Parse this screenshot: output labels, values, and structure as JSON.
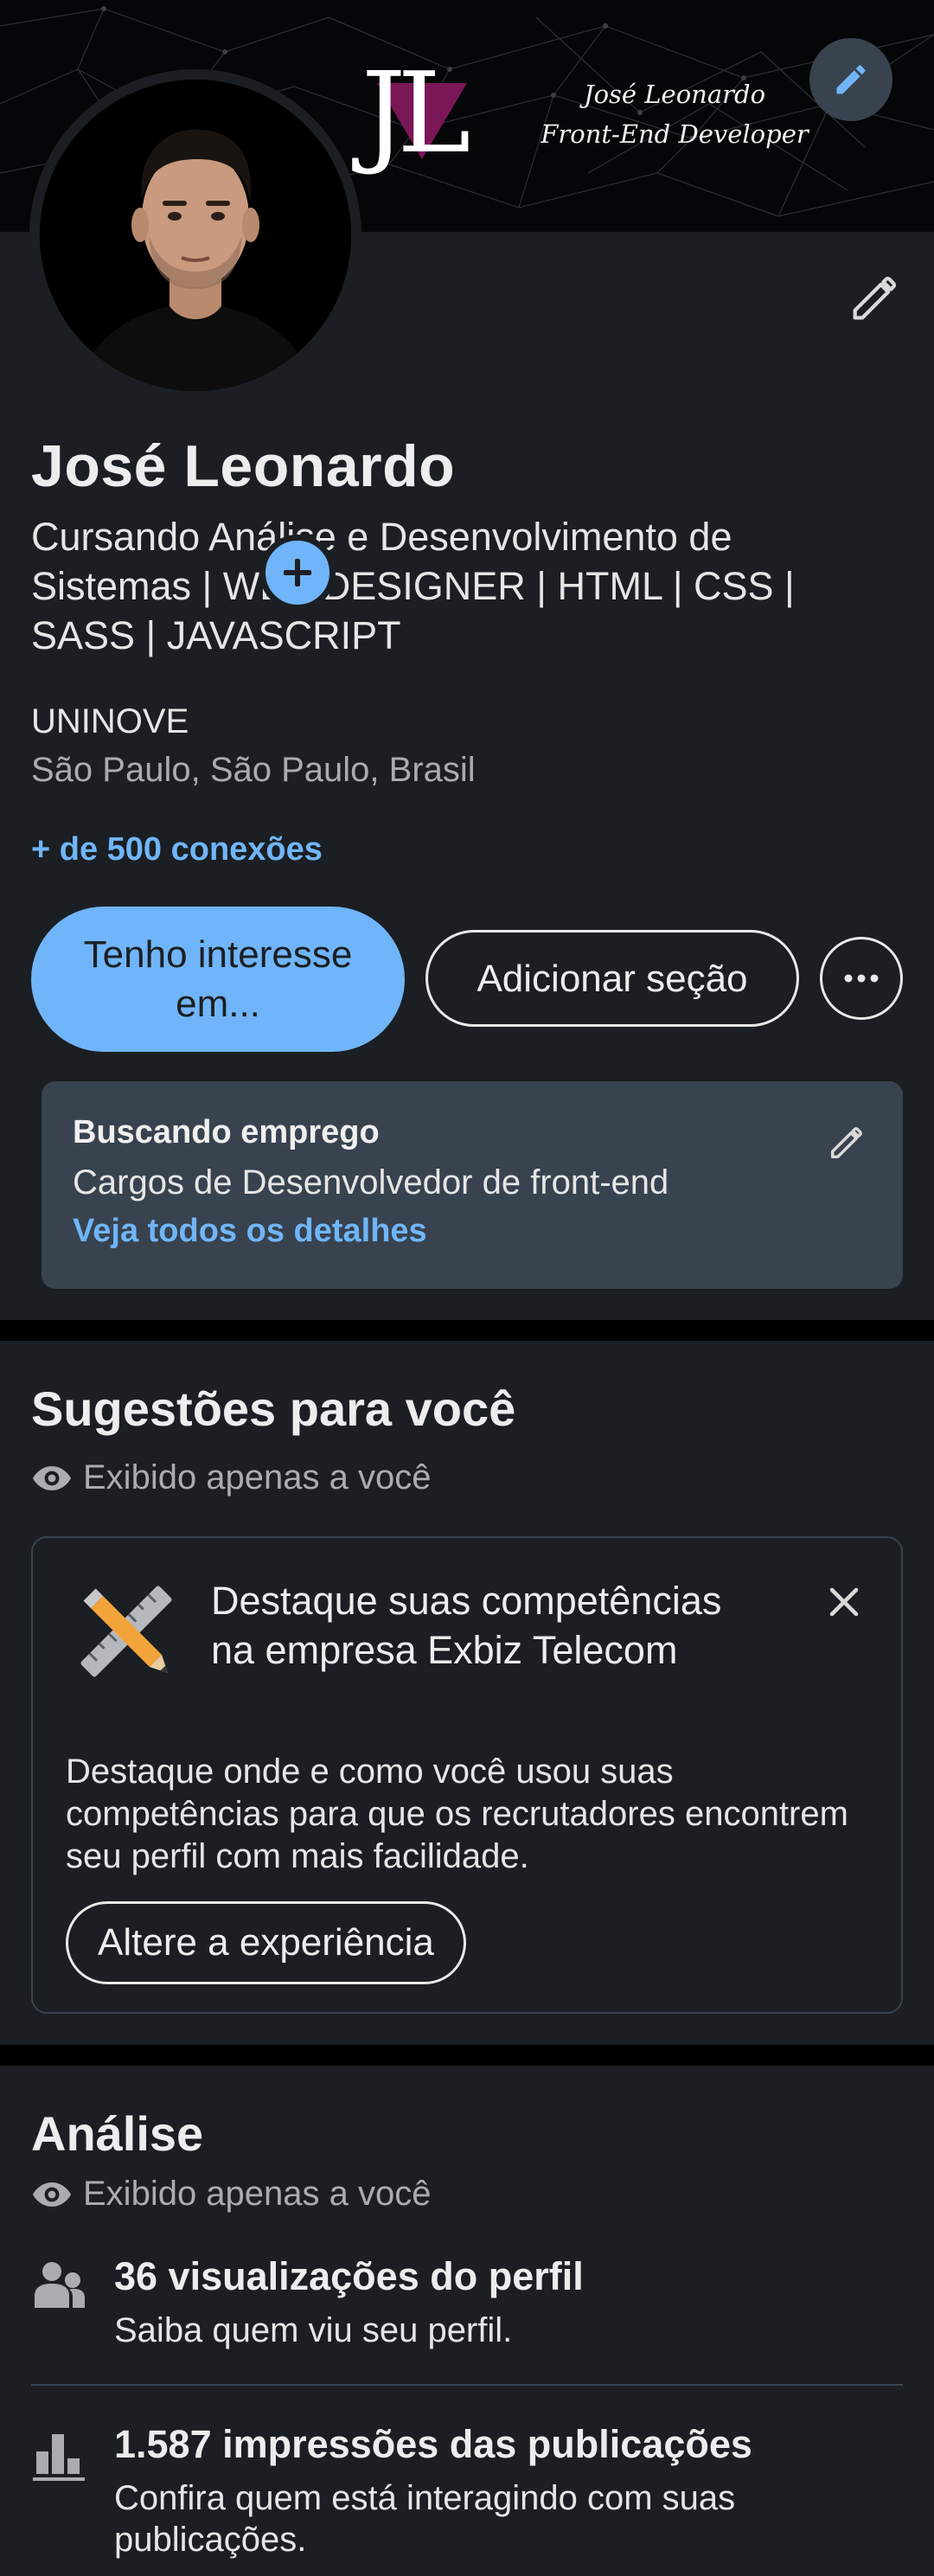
{
  "cover": {
    "logo_text": "JL",
    "name": "José Leonardo",
    "role": "Front-End Developer",
    "edit_icon": "pencil-icon"
  },
  "profile": {
    "name": "José Leonardo",
    "headline": "Cursando Análise e Desenvolvimento de Sistemas | WEB DESIGNER | HTML | CSS | SASS | JAVASCRIPT",
    "company": "UNINOVE",
    "location": "São Paulo, São Paulo, Brasil",
    "connections": "+ de 500 conexões",
    "add_photo_icon": "plus-icon"
  },
  "actions": {
    "primary": "Tenho interesse em...",
    "secondary": "Adicionar seção",
    "more_icon": "more-horizontal-icon"
  },
  "open_to_work": {
    "title": "Buscando emprego",
    "description": "Cargos de Desenvolvedor de front-end",
    "link": "Veja todos os detalhes"
  },
  "suggestions": {
    "title": "Sugestões para você",
    "private_note": "Exibido apenas a você",
    "card": {
      "heading": "Destaque suas competências na empresa Exbiz Telecom",
      "body": "Destaque onde e como você usou suas competências para que os recrutadores encontrem seu perfil com mais facilidade.",
      "button": "Altere a experiência"
    }
  },
  "analytics": {
    "title": "Análise",
    "private_note": "Exibido apenas a você",
    "items": [
      {
        "icon": "people-icon",
        "title": "36 visualizações do perfil",
        "subtitle": "Saiba quem viu seu perfil."
      },
      {
        "icon": "bar-chart-icon",
        "title": "1.587 impressões das publicações",
        "subtitle": "Confira quem está interagindo com suas publicações."
      }
    ]
  },
  "colors": {
    "background": "#1b1f23",
    "accent": "#70b5f9",
    "card": "#38434f",
    "logo_triangle": "#7a1757"
  }
}
